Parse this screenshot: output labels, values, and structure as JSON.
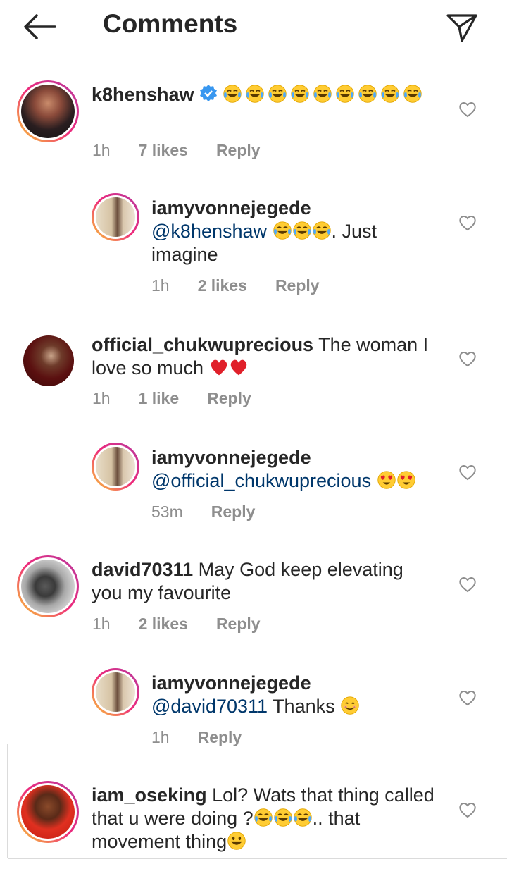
{
  "header": {
    "title": "Comments",
    "back_icon": "arrow-left-icon",
    "send_icon": "send-icon"
  },
  "comments": [
    {
      "username": "k8henshaw",
      "verified": true,
      "text_suffix": "",
      "emoji_count": 9,
      "emoji": "tears-of-joy",
      "time": "1h",
      "likes": "7 likes",
      "reply": "Reply"
    },
    {
      "username": "iamyvonnejegede",
      "mention": "@k8henshaw",
      "text_suffix": ". Just imagine",
      "emoji_count": 3,
      "emoji": "tears-of-joy",
      "time": "1h",
      "likes": "2 likes",
      "reply": "Reply"
    },
    {
      "username": "official_chukwuprecious",
      "text": "The woman I love so much",
      "emoji": "red-heart",
      "emoji_count": 2,
      "time": "1h",
      "likes": "1 like",
      "reply": "Reply"
    },
    {
      "username": "iamyvonnejegede",
      "mention": "@official_chukwuprecious",
      "emoji": "heart-eyes",
      "emoji_count": 2,
      "time": "53m",
      "reply": "Reply"
    },
    {
      "username": "david70311",
      "text": "May God keep elevating you my favourite",
      "time": "1h",
      "likes": "2 likes",
      "reply": "Reply"
    },
    {
      "username": "iamyvonnejegede",
      "mention": "@david70311",
      "text": "Thanks",
      "emoji": "smiling-face",
      "time": "1h",
      "reply": "Reply"
    },
    {
      "username": "iam_oseking",
      "text": "Lol? Wats that thing called that u were doing ?",
      "text_mid": ".. that movement thing",
      "emoji": "tears-of-joy",
      "emoji_count": 3
    }
  ],
  "colors": {
    "text": "#262626",
    "meta": "#8e8e8e",
    "mention": "#00376b",
    "verified": "#3897f0",
    "heart_red": "#ed1c24"
  }
}
